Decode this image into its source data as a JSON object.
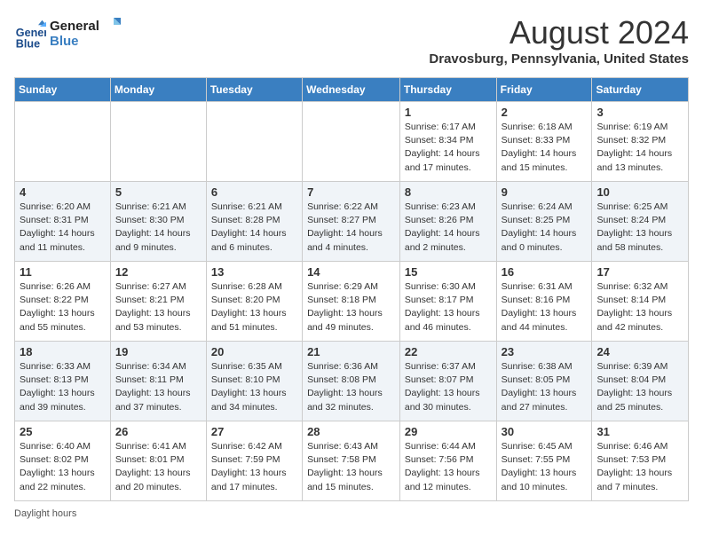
{
  "header": {
    "logo_line1": "General",
    "logo_line2": "Blue",
    "month_title": "August 2024",
    "location": "Dravosburg, Pennsylvania, United States"
  },
  "days_of_week": [
    "Sunday",
    "Monday",
    "Tuesday",
    "Wednesday",
    "Thursday",
    "Friday",
    "Saturday"
  ],
  "weeks": [
    [
      {
        "day": "",
        "info": ""
      },
      {
        "day": "",
        "info": ""
      },
      {
        "day": "",
        "info": ""
      },
      {
        "day": "",
        "info": ""
      },
      {
        "day": "1",
        "info": "Sunrise: 6:17 AM\nSunset: 8:34 PM\nDaylight: 14 hours\nand 17 minutes."
      },
      {
        "day": "2",
        "info": "Sunrise: 6:18 AM\nSunset: 8:33 PM\nDaylight: 14 hours\nand 15 minutes."
      },
      {
        "day": "3",
        "info": "Sunrise: 6:19 AM\nSunset: 8:32 PM\nDaylight: 14 hours\nand 13 minutes."
      }
    ],
    [
      {
        "day": "4",
        "info": "Sunrise: 6:20 AM\nSunset: 8:31 PM\nDaylight: 14 hours\nand 11 minutes."
      },
      {
        "day": "5",
        "info": "Sunrise: 6:21 AM\nSunset: 8:30 PM\nDaylight: 14 hours\nand 9 minutes."
      },
      {
        "day": "6",
        "info": "Sunrise: 6:21 AM\nSunset: 8:28 PM\nDaylight: 14 hours\nand 6 minutes."
      },
      {
        "day": "7",
        "info": "Sunrise: 6:22 AM\nSunset: 8:27 PM\nDaylight: 14 hours\nand 4 minutes."
      },
      {
        "day": "8",
        "info": "Sunrise: 6:23 AM\nSunset: 8:26 PM\nDaylight: 14 hours\nand 2 minutes."
      },
      {
        "day": "9",
        "info": "Sunrise: 6:24 AM\nSunset: 8:25 PM\nDaylight: 14 hours\nand 0 minutes."
      },
      {
        "day": "10",
        "info": "Sunrise: 6:25 AM\nSunset: 8:24 PM\nDaylight: 13 hours\nand 58 minutes."
      }
    ],
    [
      {
        "day": "11",
        "info": "Sunrise: 6:26 AM\nSunset: 8:22 PM\nDaylight: 13 hours\nand 55 minutes."
      },
      {
        "day": "12",
        "info": "Sunrise: 6:27 AM\nSunset: 8:21 PM\nDaylight: 13 hours\nand 53 minutes."
      },
      {
        "day": "13",
        "info": "Sunrise: 6:28 AM\nSunset: 8:20 PM\nDaylight: 13 hours\nand 51 minutes."
      },
      {
        "day": "14",
        "info": "Sunrise: 6:29 AM\nSunset: 8:18 PM\nDaylight: 13 hours\nand 49 minutes."
      },
      {
        "day": "15",
        "info": "Sunrise: 6:30 AM\nSunset: 8:17 PM\nDaylight: 13 hours\nand 46 minutes."
      },
      {
        "day": "16",
        "info": "Sunrise: 6:31 AM\nSunset: 8:16 PM\nDaylight: 13 hours\nand 44 minutes."
      },
      {
        "day": "17",
        "info": "Sunrise: 6:32 AM\nSunset: 8:14 PM\nDaylight: 13 hours\nand 42 minutes."
      }
    ],
    [
      {
        "day": "18",
        "info": "Sunrise: 6:33 AM\nSunset: 8:13 PM\nDaylight: 13 hours\nand 39 minutes."
      },
      {
        "day": "19",
        "info": "Sunrise: 6:34 AM\nSunset: 8:11 PM\nDaylight: 13 hours\nand 37 minutes."
      },
      {
        "day": "20",
        "info": "Sunrise: 6:35 AM\nSunset: 8:10 PM\nDaylight: 13 hours\nand 34 minutes."
      },
      {
        "day": "21",
        "info": "Sunrise: 6:36 AM\nSunset: 8:08 PM\nDaylight: 13 hours\nand 32 minutes."
      },
      {
        "day": "22",
        "info": "Sunrise: 6:37 AM\nSunset: 8:07 PM\nDaylight: 13 hours\nand 30 minutes."
      },
      {
        "day": "23",
        "info": "Sunrise: 6:38 AM\nSunset: 8:05 PM\nDaylight: 13 hours\nand 27 minutes."
      },
      {
        "day": "24",
        "info": "Sunrise: 6:39 AM\nSunset: 8:04 PM\nDaylight: 13 hours\nand 25 minutes."
      }
    ],
    [
      {
        "day": "25",
        "info": "Sunrise: 6:40 AM\nSunset: 8:02 PM\nDaylight: 13 hours\nand 22 minutes."
      },
      {
        "day": "26",
        "info": "Sunrise: 6:41 AM\nSunset: 8:01 PM\nDaylight: 13 hours\nand 20 minutes."
      },
      {
        "day": "27",
        "info": "Sunrise: 6:42 AM\nSunset: 7:59 PM\nDaylight: 13 hours\nand 17 minutes."
      },
      {
        "day": "28",
        "info": "Sunrise: 6:43 AM\nSunset: 7:58 PM\nDaylight: 13 hours\nand 15 minutes."
      },
      {
        "day": "29",
        "info": "Sunrise: 6:44 AM\nSunset: 7:56 PM\nDaylight: 13 hours\nand 12 minutes."
      },
      {
        "day": "30",
        "info": "Sunrise: 6:45 AM\nSunset: 7:55 PM\nDaylight: 13 hours\nand 10 minutes."
      },
      {
        "day": "31",
        "info": "Sunrise: 6:46 AM\nSunset: 7:53 PM\nDaylight: 13 hours\nand 7 minutes."
      }
    ]
  ],
  "footer": {
    "daylight_label": "Daylight hours"
  }
}
